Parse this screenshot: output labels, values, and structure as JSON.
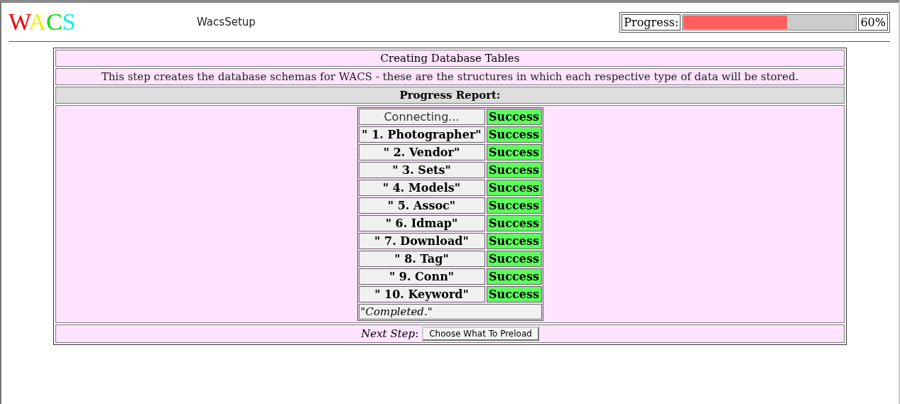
{
  "logo": [
    {
      "letter": "W",
      "color": "#ee0000"
    },
    {
      "letter": "A",
      "color": "#eeee00"
    },
    {
      "letter": "C",
      "color": "#00dd00"
    },
    {
      "letter": "S",
      "color": "#00eeee"
    }
  ],
  "app_title": "WacsSetup",
  "progress": {
    "label": "Progress:",
    "level": 0.6,
    "reading": "60%"
  },
  "panel": {
    "title": "Creating Database Tables",
    "description": "This step creates the database schemas for WACS - these are the structures in which each respective type of data will be stored.",
    "report_heading": "Progress Report:",
    "report": [
      {
        "kind": "connect",
        "step": "Connecting...",
        "status": "Success"
      },
      {
        "kind": "table",
        "step": "\" 1. Photographer\"",
        "status": "Success"
      },
      {
        "kind": "table",
        "step": "\" 2. Vendor\"",
        "status": "Success"
      },
      {
        "kind": "table",
        "step": "\" 3. Sets\"",
        "status": "Success"
      },
      {
        "kind": "table",
        "step": "\" 4. Models\"",
        "status": "Success"
      },
      {
        "kind": "table",
        "step": "\" 5. Assoc\"",
        "status": "Success"
      },
      {
        "kind": "table",
        "step": "\" 6. Idmap\"",
        "status": "Success"
      },
      {
        "kind": "table",
        "step": "\" 7. Download\"",
        "status": "Success"
      },
      {
        "kind": "table",
        "step": "\" 8. Tag\"",
        "status": "Success"
      },
      {
        "kind": "table",
        "step": "\" 9. Conn\"",
        "status": "Success"
      },
      {
        "kind": "table",
        "step": "\" 10. Keyword\"",
        "status": "Success"
      }
    ],
    "completion": "\"Completed.\"",
    "next_step_label": "*Next Step*:",
    "next_step_button": "Choose What To Preload"
  }
}
